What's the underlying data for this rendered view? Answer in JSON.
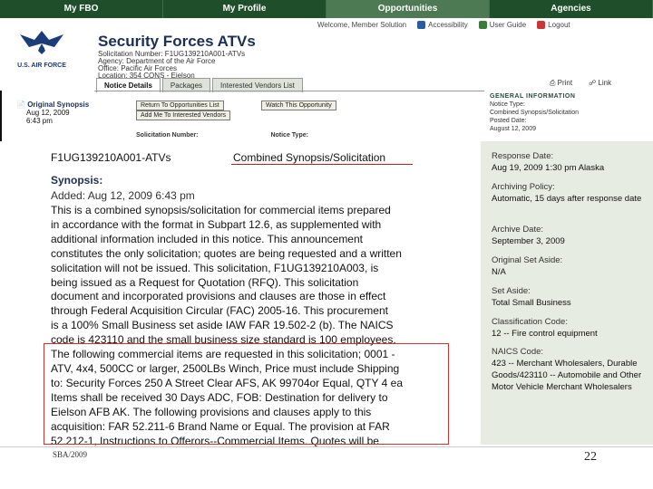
{
  "nav": {
    "tabs": [
      "My FBO",
      "My Profile",
      "Opportunities",
      "Agencies"
    ],
    "active_index": 2
  },
  "colors": {
    "nav_bg": "#1f4f2a",
    "accent": "#1a2f55",
    "highlight": "#c33"
  },
  "header": {
    "title": "Security Forces ATVs",
    "solicitation": "Solicitation Number: F1UG139210A001-ATVs",
    "agency": "Agency: Department of the Air Force",
    "office": "Office: Pacific Air Forces",
    "location": "Location: 354 CONS - Eielson",
    "logo_text": "U.S. AIR FORCE"
  },
  "utility": {
    "user": "Welcome, Member Solution",
    "accessibility": "Accessibility",
    "user_guide": "User Guide",
    "logout": "Logout"
  },
  "tabs": [
    "Notice Details",
    "Packages",
    "Interested Vendors List"
  ],
  "left_actions": {
    "original_synopsis": "Original Synopsis",
    "orig_date": "Aug 12, 2009",
    "orig_time": "6:43 pm",
    "return_btn": "Return To Opportunities List",
    "watch_btn": "Watch This Opportunity",
    "add_btn": "Add Me To Interested Vendors"
  },
  "tools": {
    "print": "Print",
    "link": "Link"
  },
  "general_info_top": {
    "heading": "GENERAL INFORMATION",
    "notice_type_label": "Notice Type:",
    "notice_type": "Combined Synopsis/Solicitation",
    "posted_label": "Posted Date:",
    "posted": "August 12, 2009"
  },
  "zoom_labels": {
    "sol": "Solicitation Number:",
    "notice": "Notice Type:"
  },
  "main": {
    "sol_number": "F1UG139210A001-ATVs",
    "notice_type": "Combined Synopsis/Solicitation",
    "synopsis_heading": "Synopsis:",
    "added": "Added: Aug 12, 2009 6:43 pm",
    "body_lines": [
      "This is a combined synopsis/solicitation for commercial items prepared",
      "in accordance with the format in Subpart 12.6, as supplemented with",
      "additional information included in this notice. This announcement",
      "constitutes the only solicitation; quotes are being requested and a written",
      "solicitation will not be issued. This solicitation, F1UG139210A003, is",
      "being issued as a Request for Quotation (RFQ). This solicitation",
      "document and incorporated provisions and clauses are those in effect",
      "through Federal Acquisition Circular (FAC) 2005-16. This procurement",
      "is a 100% Small Business set aside IAW FAR 19.502-2 (b). The NAICS",
      "code is 423110 and the small business size standard is 100 employees.",
      "The following commercial items are requested in this solicitation; 0001 -",
      "ATV, 4x4, 500CC or larger, 2500LBs Winch, Price must include Shipping",
      "to: Security Forces 250 A Street Clear AFS, AK 99704or Equal, QTY 4 ea",
      "Items shall be received 30 Days ADC, FOB: Destination for delivery to",
      "Eielson AFB AK. The following provisions and clauses apply to this",
      "acquisition: FAR 52.211-6 Brand Name or Equal. The provision at FAR",
      "52.212-1, Instructions to Offerors--Commercial Items. Quotes will be"
    ]
  },
  "sidebar": [
    {
      "label": "Response Date:",
      "value": "Aug 19, 2009 1:30 pm Alaska"
    },
    {
      "label": "Archiving Policy:",
      "value": "Automatic, 15 days after response date"
    },
    {
      "label": "Archive Date:",
      "value": "September 3, 2009"
    },
    {
      "label": "Original Set Aside:",
      "value": "N/A"
    },
    {
      "label": "Set Aside:",
      "value": "Total Small Business"
    },
    {
      "label": "Classification Code:",
      "value": "12 -- Fire control equipment"
    },
    {
      "label": "NAICS Code:",
      "value": "423 -- Merchant Wholesalers, Durable Goods/423110 -- Automobile and Other Motor Vehicle Merchant Wholesalers"
    }
  ],
  "footer": {
    "left": "SBA/2009",
    "page": "22"
  }
}
